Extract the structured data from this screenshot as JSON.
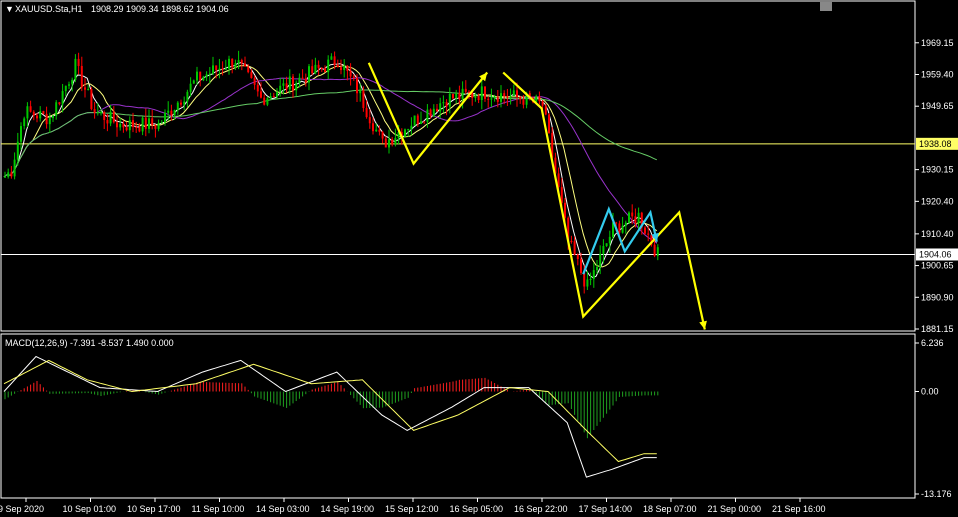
{
  "header": {
    "symbol_label": "XAUUSD.Sta,H1",
    "ohlc_text": "1908.29 1909.34 1898.62 1904.06",
    "dropdown_glyph": "▼"
  },
  "macd_header": "MACD(12,26,9) -7.391 -8.537 1.490 0.000",
  "colors": {
    "background": "#000000",
    "bull_candle": "#00c800",
    "bear_candle": "#ff0000",
    "ma_fast": "#ffffff",
    "ma_mid": "#ffff80",
    "ma_slow_purple": "#9933cc",
    "ma_slow_green": "#66cc66",
    "hline": "#ffff66",
    "grid_border": "#ffffff",
    "arrow_yellow": "#ffff00",
    "arrow_cyan": "#33ccee",
    "hist_pos": "#ff2020",
    "hist_neg": "#20a020",
    "macd_line": "#ffffff",
    "signal_line": "#ffff66"
  },
  "chart_data": [
    {
      "type": "candlestick",
      "symbol": "XAUUSD.Sta",
      "timeframe": "H1",
      "ylim": [
        1881.15,
        1978
      ],
      "y_ticks": [
        1969.15,
        1959.4,
        1949.65,
        1930.15,
        1920.4,
        1910.4,
        1900.65,
        1890.9,
        1881.15
      ],
      "y_tick_labels": [
        "1969.15",
        "1959.40",
        "1949.65",
        "1930.15",
        "1920.40",
        "1910.40",
        "1900.65",
        "1890.90",
        "1881.15"
      ],
      "x_labels": [
        "9 Sep 2020",
        "10 Sep 01:00",
        "10 Sep 17:00",
        "11 Sep 10:00",
        "14 Sep 03:00",
        "14 Sep 19:00",
        "15 Sep 12:00",
        "16 Sep 05:00",
        "16 Sep 22:00",
        "17 Sep 14:00",
        "18 Sep 07:00",
        "21 Sep 00:00",
        "21 Sep 16:00"
      ],
      "horizontal_lines": [
        {
          "value": 1938.08,
          "label": "1938.08",
          "tag_color": "#ffff66"
        },
        {
          "value": 1904.06,
          "label": "1904.06",
          "tag_color": "#ffffff"
        }
      ],
      "price_path_waypoints": [
        {
          "bar": 0,
          "price": 1928
        },
        {
          "bar": 2,
          "price": 1930
        },
        {
          "bar": 6,
          "price": 1948
        },
        {
          "bar": 14,
          "price": 1946
        },
        {
          "bar": 22,
          "price": 1962
        },
        {
          "bar": 28,
          "price": 1948
        },
        {
          "bar": 36,
          "price": 1944
        },
        {
          "bar": 48,
          "price": 1944
        },
        {
          "bar": 60,
          "price": 1958
        },
        {
          "bar": 72,
          "price": 1964
        },
        {
          "bar": 80,
          "price": 1952
        },
        {
          "bar": 92,
          "price": 1958
        },
        {
          "bar": 104,
          "price": 1964
        },
        {
          "bar": 110,
          "price": 1955
        },
        {
          "bar": 118,
          "price": 1938
        },
        {
          "bar": 126,
          "price": 1944
        },
        {
          "bar": 138,
          "price": 1952
        },
        {
          "bar": 150,
          "price": 1954
        },
        {
          "bar": 162,
          "price": 1952
        },
        {
          "bar": 168,
          "price": 1950
        },
        {
          "bar": 176,
          "price": 1908
        },
        {
          "bar": 182,
          "price": 1894
        },
        {
          "bar": 190,
          "price": 1912
        },
        {
          "bar": 198,
          "price": 1916
        },
        {
          "bar": 204,
          "price": 1904
        }
      ],
      "arrows_yellow": [
        [
          {
            "bar": 114,
            "price": 1963
          },
          {
            "bar": 128,
            "price": 1932
          },
          {
            "bar": 151,
            "price": 1960
          }
        ],
        [
          {
            "bar": 156,
            "price": 1960
          },
          {
            "bar": 168,
            "price": 1949
          },
          {
            "bar": 181,
            "price": 1885
          },
          {
            "bar": 211,
            "price": 1917
          },
          {
            "bar": 219,
            "price": 1881
          }
        ]
      ],
      "arrows_cyan": [
        [
          {
            "bar": 181,
            "price": 1898
          },
          {
            "bar": 189,
            "price": 1918
          },
          {
            "bar": 194,
            "price": 1905
          },
          {
            "bar": 202,
            "price": 1917
          },
          {
            "bar": 204,
            "price": 1908
          }
        ]
      ]
    },
    {
      "type": "macd",
      "params": "12,26,9",
      "ylim": [
        -13.176,
        6.236
      ],
      "y_tick_labels": [
        "6.236",
        "0.00",
        "-13.176"
      ],
      "macd_waypoints": [
        {
          "bar": 0,
          "value": 0
        },
        {
          "bar": 10,
          "value": 4.5
        },
        {
          "bar": 20,
          "value": 2.5
        },
        {
          "bar": 30,
          "value": 0.5
        },
        {
          "bar": 48,
          "value": 0
        },
        {
          "bar": 62,
          "value": 2.5
        },
        {
          "bar": 74,
          "value": 4
        },
        {
          "bar": 88,
          "value": 0
        },
        {
          "bar": 104,
          "value": 2.5
        },
        {
          "bar": 118,
          "value": -3
        },
        {
          "bar": 126,
          "value": -5
        },
        {
          "bar": 140,
          "value": -2
        },
        {
          "bar": 150,
          "value": 0.5
        },
        {
          "bar": 164,
          "value": 0.5
        },
        {
          "bar": 176,
          "value": -4
        },
        {
          "bar": 182,
          "value": -11
        },
        {
          "bar": 190,
          "value": -10
        },
        {
          "bar": 200,
          "value": -8.5
        }
      ],
      "signal_waypoints": [
        {
          "bar": 0,
          "value": 1
        },
        {
          "bar": 14,
          "value": 4
        },
        {
          "bar": 26,
          "value": 1.5
        },
        {
          "bar": 40,
          "value": 0
        },
        {
          "bar": 60,
          "value": 1
        },
        {
          "bar": 78,
          "value": 3.5
        },
        {
          "bar": 96,
          "value": 1
        },
        {
          "bar": 112,
          "value": 1.5
        },
        {
          "bar": 128,
          "value": -5
        },
        {
          "bar": 142,
          "value": -3
        },
        {
          "bar": 158,
          "value": 0.5
        },
        {
          "bar": 170,
          "value": 0
        },
        {
          "bar": 182,
          "value": -5
        },
        {
          "bar": 192,
          "value": -9
        },
        {
          "bar": 200,
          "value": -8
        }
      ],
      "last_values": {
        "macd": -7.391,
        "signal": -8.537,
        "histogram": 1.49,
        "zero": 0.0
      }
    }
  ]
}
